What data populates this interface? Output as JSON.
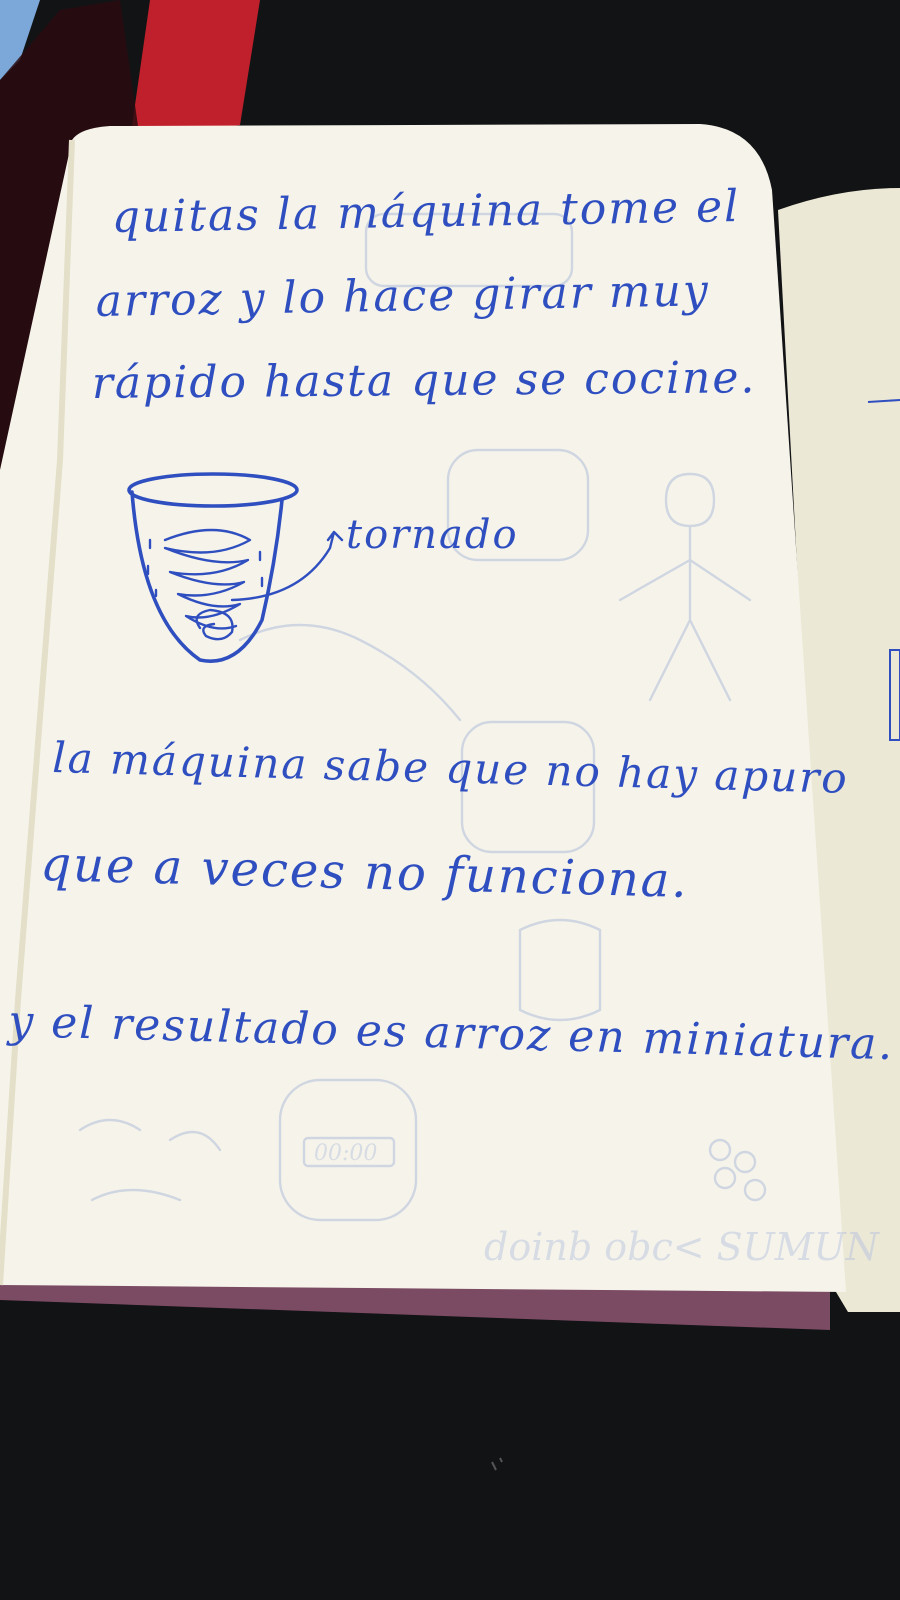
{
  "notebook": {
    "lines": [
      "quitas la máquina tome el",
      "arroz y lo hace girar muy",
      "rápido hasta que se cocine.",
      "la máquina sabe que no hay apuro",
      "que a veces no funciona.",
      "y el resultado es arroz en miniatura."
    ],
    "sketch_label": "tornado",
    "bleed_through": [
      "00:00",
      "doinb obc< SUMUN"
    ]
  },
  "colors": {
    "ink": "#2f4fc0",
    "paper": "#f6f4ea",
    "background": "#111214",
    "cover_red": "#c0202b"
  }
}
